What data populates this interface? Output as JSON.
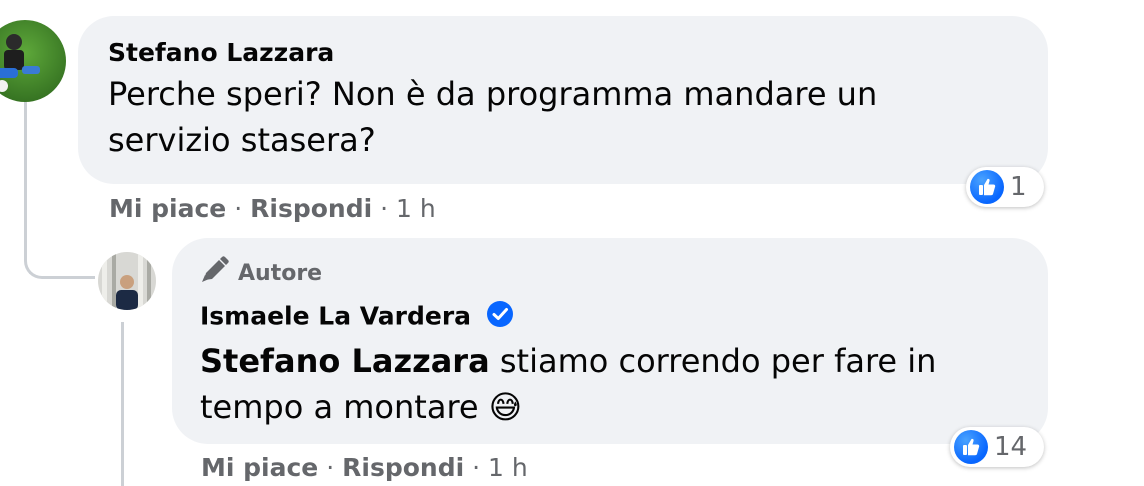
{
  "comment": {
    "author": "Stefano Lazzara",
    "text": "Perche speri? Non è da programma mandare un servizio stasera?",
    "actions": {
      "like": "Mi piace",
      "reply": "Rispondi",
      "separator": "·",
      "time": "1 h"
    },
    "reactions": {
      "icon": "like-icon",
      "count": "1"
    }
  },
  "reply": {
    "badge_label": "Autore",
    "badge_icon": "pencil-icon",
    "author": "Ismaele La Vardera",
    "verified_icon": "verified-badge-icon",
    "mention": "Stefano Lazzara",
    "text": " stiamo correndo per fare in tempo a montare ",
    "emoji": "😅",
    "actions": {
      "like": "Mi piace",
      "reply": "Rispondi",
      "separator": "·",
      "time": "1 h"
    },
    "reactions": {
      "icon": "like-icon",
      "count": "14"
    }
  },
  "colors": {
    "bubble": "#f0f2f5",
    "secondary_text": "#65676b",
    "like_blue": "#0866ff",
    "thread_line": "#ccd0d5"
  }
}
